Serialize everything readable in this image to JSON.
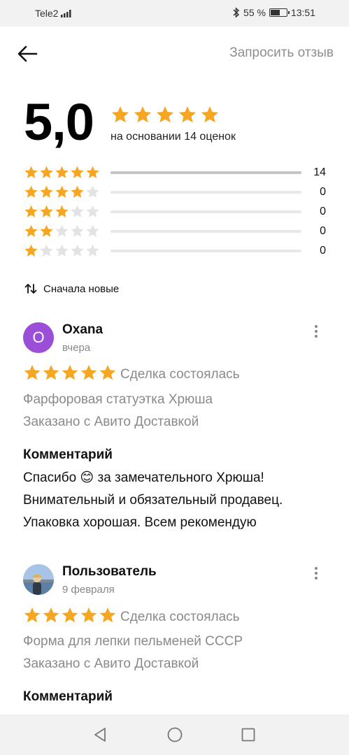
{
  "status_bar": {
    "carrier": "Tele2",
    "battery_percent": "55 %",
    "time": "13:51",
    "bluetooth_icon": "bluetooth-icon"
  },
  "header": {
    "back_icon": "arrow-left-icon",
    "request_review": "Запросить отзыв"
  },
  "summary": {
    "score": "5,0",
    "stars": 5,
    "caption": "на основании 14 оценок"
  },
  "histogram": [
    {
      "stars": 5,
      "count": "14",
      "fraction": 1.0
    },
    {
      "stars": 4,
      "count": "0",
      "fraction": 0
    },
    {
      "stars": 3,
      "count": "0",
      "fraction": 0
    },
    {
      "stars": 2,
      "count": "0",
      "fraction": 0
    },
    {
      "stars": 1,
      "count": "0",
      "fraction": 0
    }
  ],
  "sort": {
    "icon": "sort-arrows-icon",
    "label": "Сначала новые"
  },
  "reviews": [
    {
      "avatar_letter": "O",
      "author": "Oxana",
      "date": "вчера",
      "stars": 5,
      "status": "Сделка состоялась",
      "item": "Фарфоровая статуэтка Хрюша",
      "delivery": "Заказано с Авито Доставкой",
      "comment_title": "Комментарий",
      "comment_text": "Спасибо 😊 за замечательного Хрюша! Внимательный и обязательный продавец. Упаковка хорошая. Всем рекомендую"
    },
    {
      "avatar_letter": "",
      "author": "Пользователь",
      "date": "9 февраля",
      "stars": 5,
      "status": "Сделка состоялась",
      "item": "Форма для лепки пельменей СССР",
      "delivery": "Заказано с Авито Доставкой",
      "comment_title": "Комментарий"
    }
  ],
  "colors": {
    "star": "#f5a623",
    "star_empty": "#e3e3e3",
    "avatar": "#9b4fd6",
    "muted_text": "#8a8a8a"
  }
}
